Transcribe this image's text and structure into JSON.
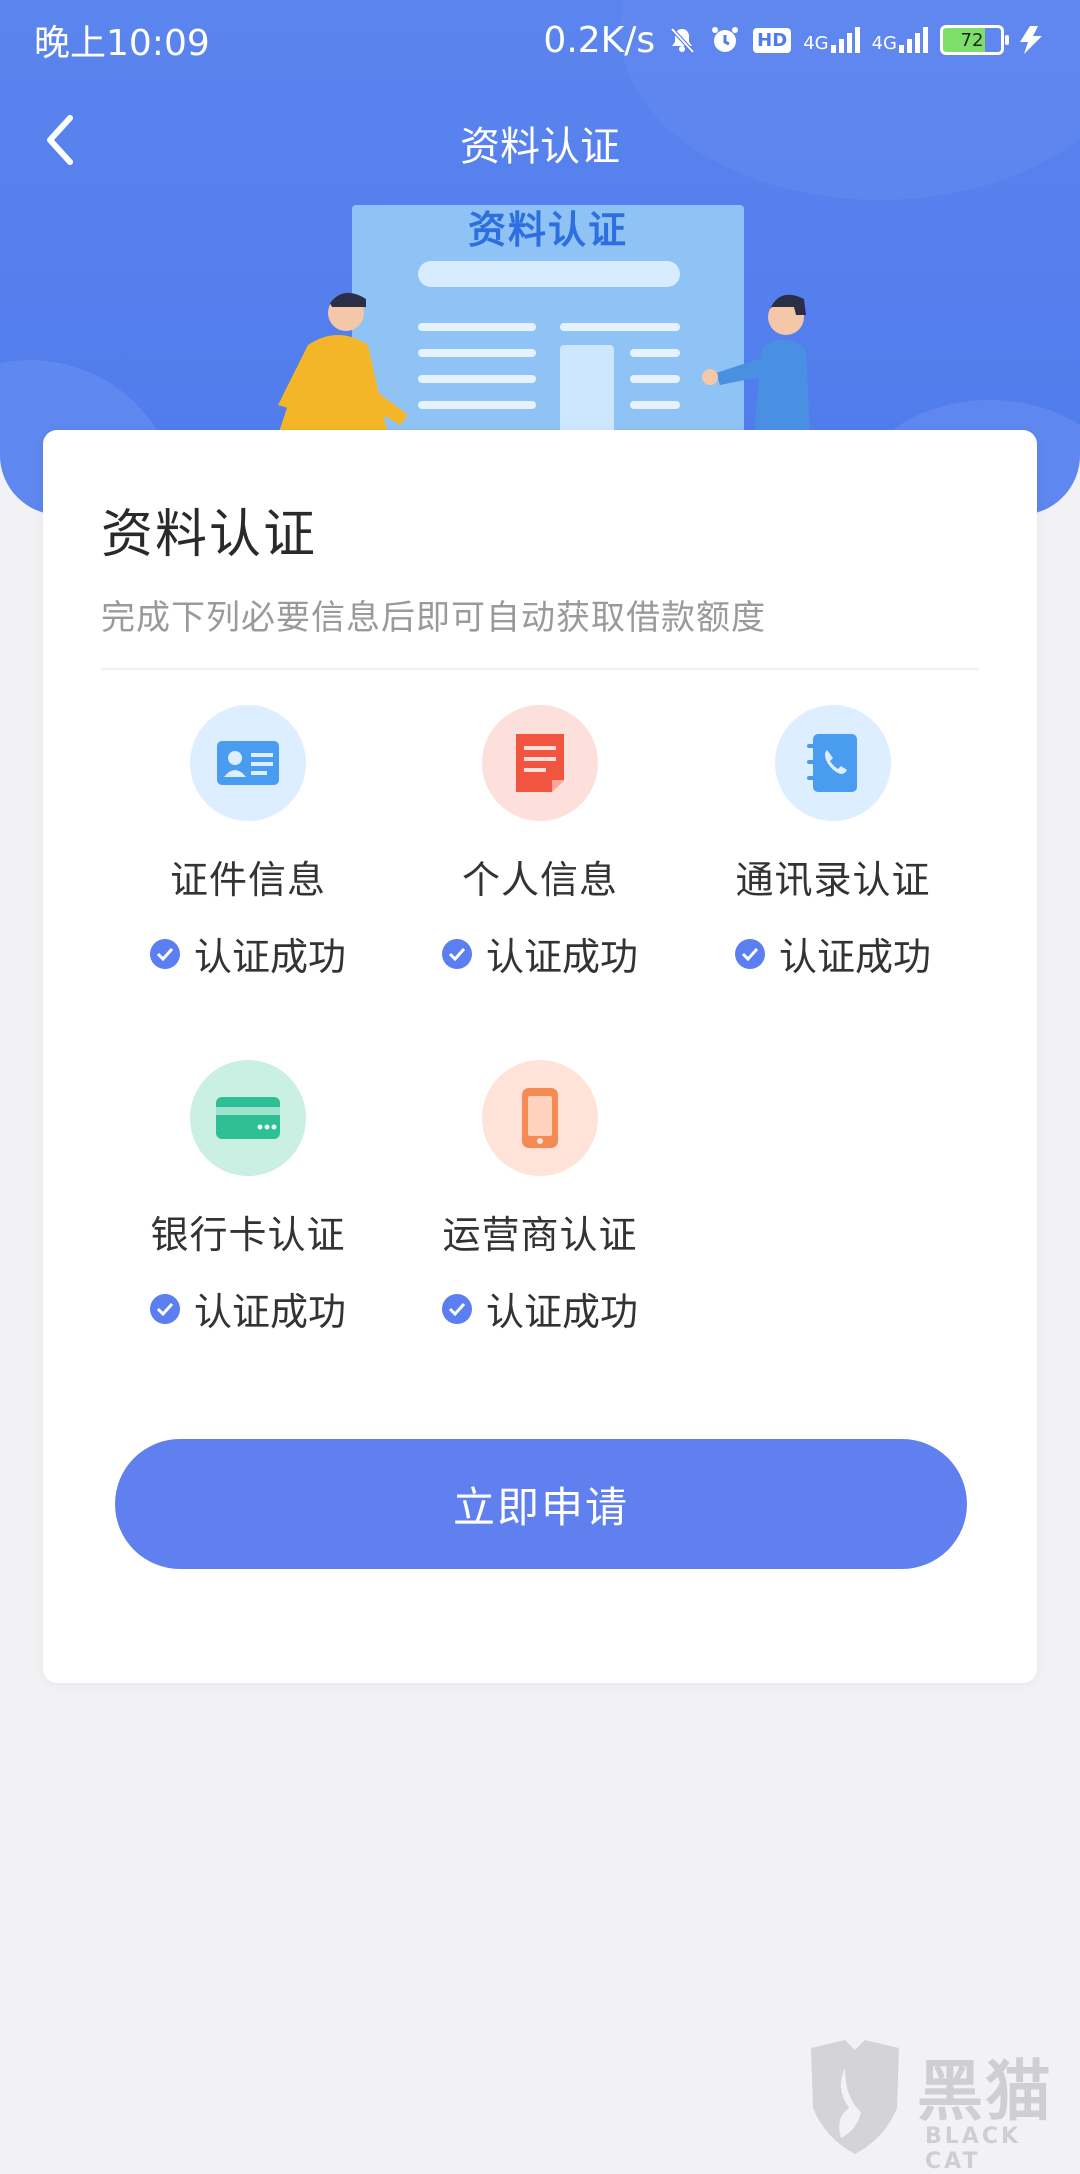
{
  "status_bar": {
    "time": "晚上10:09",
    "net_speed": "0.2K/s",
    "hd": "HD",
    "signal1": "4G",
    "signal2": "4G",
    "battery": "72"
  },
  "nav": {
    "title": "资料认证",
    "back_icon": "chevron-left-icon"
  },
  "banner": {
    "doc_title": "资料认证"
  },
  "card": {
    "title": "资料认证",
    "subtitle": "完成下列必要信息后即可自动获取借款额度",
    "items": [
      {
        "name": "证件信息",
        "status": "认证成功",
        "icon": "id-card-icon",
        "bg": "#dceeff",
        "color": "#4a9cf0"
      },
      {
        "name": "个人信息",
        "status": "认证成功",
        "icon": "document-icon",
        "bg": "#fde0dc",
        "color": "#f2553f"
      },
      {
        "name": "通讯录认证",
        "status": "认证成功",
        "icon": "contacts-book-icon",
        "bg": "#dceeff",
        "color": "#4a9cf0"
      },
      {
        "name": "银行卡认证",
        "status": "认证成功",
        "icon": "bank-card-icon",
        "bg": "#c9f0e2",
        "color": "#2fbf96"
      },
      {
        "name": "运营商认证",
        "status": "认证成功",
        "icon": "mobile-phone-icon",
        "bg": "#ffe3d8",
        "color": "#f58a55"
      }
    ],
    "apply_label": "立即申请"
  },
  "watermark": {
    "cn": "黑猫",
    "en": "BLACK CAT"
  },
  "colors": {
    "header_blue": "#4f7bec",
    "button_blue": "#6180ef",
    "check_blue": "#5b7ef0"
  }
}
